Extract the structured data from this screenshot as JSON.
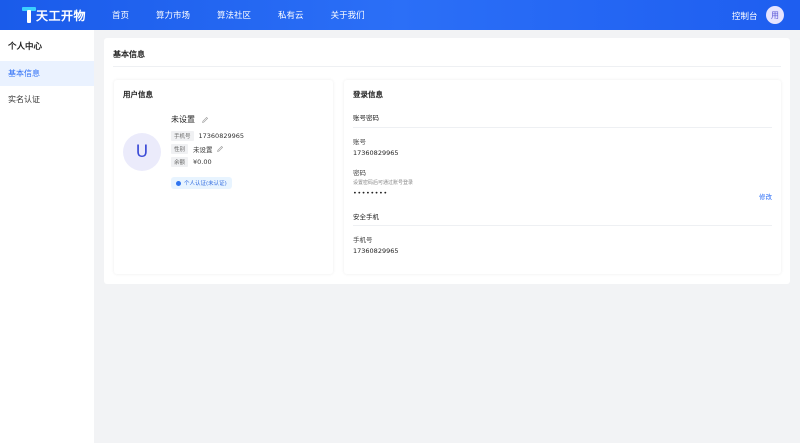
{
  "header": {
    "logo_text": "天工开物",
    "nav": [
      "首页",
      "算力市场",
      "算法社区",
      "私有云",
      "关于我们"
    ],
    "console": "控制台",
    "avatar": "用"
  },
  "sidebar": {
    "title": "个人中心",
    "items": [
      {
        "label": "基本信息",
        "active": true
      },
      {
        "label": "实名认证",
        "active": false
      }
    ]
  },
  "main": {
    "title": "基本信息",
    "user_info": {
      "title": "用户信息",
      "avatar_letter": "U",
      "name": "未设置",
      "phone_tag": "手机号",
      "phone": "17360829965",
      "gender_tag": "性别",
      "gender": "未设置",
      "balance_tag": "余额",
      "balance": "¥0.00",
      "verify_badge": "个人认证(未认证)"
    },
    "login_info": {
      "title": "登录信息",
      "account_section": "账号密码",
      "account_label": "账号",
      "account_value": "17360829965",
      "password_label": "密码",
      "password_hint": "设置密码后可通过账号登录",
      "password_value": "••••••••",
      "modify": "修改",
      "phone_section": "安全手机",
      "phone_label": "手机号",
      "phone_value": "17360829965"
    }
  },
  "colors": {
    "header_blue": "#1e5ef0",
    "accent": "#2a6cf6",
    "active_bg": "#eaf2ff"
  }
}
